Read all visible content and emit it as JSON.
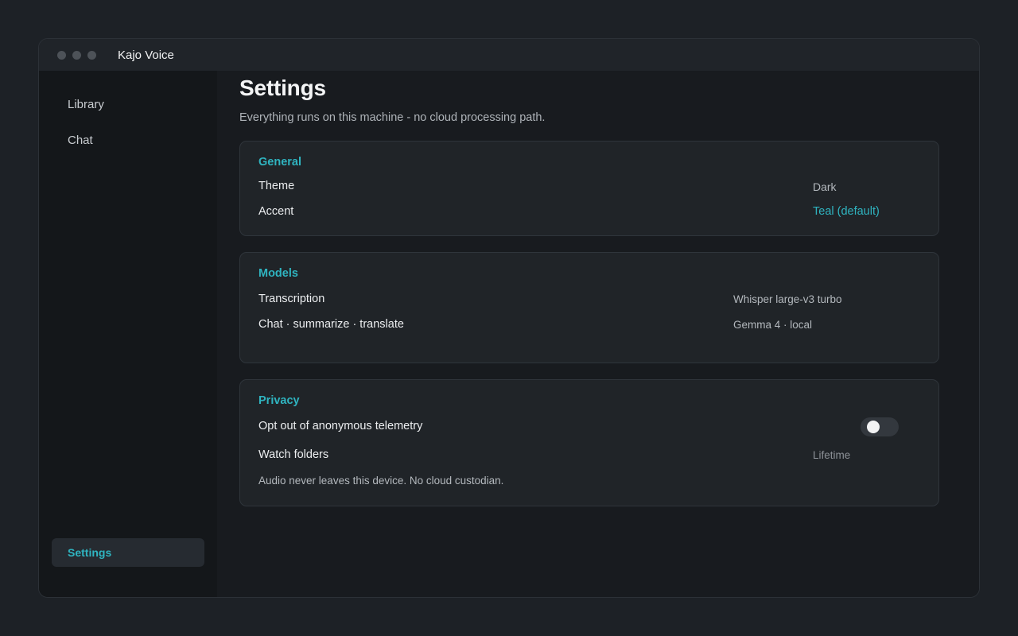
{
  "app": {
    "title": "Kajo Voice"
  },
  "sidebar": {
    "items": [
      {
        "label": "Library",
        "active": false
      },
      {
        "label": "Chat",
        "active": false
      },
      {
        "label": "Settings",
        "active": true
      }
    ]
  },
  "page": {
    "title": "Settings",
    "subtitle": "Everything runs on this machine - no cloud processing path."
  },
  "sections": {
    "general": {
      "title": "General",
      "theme_label": "Theme",
      "theme_value": "Dark",
      "accent_label": "Accent",
      "accent_value": "Teal (default)"
    },
    "models": {
      "title": "Models",
      "transcription_label": "Transcription",
      "transcription_value": "Whisper large-v3 turbo",
      "chat_label": "Chat · summarize · translate",
      "chat_value": "Gemma 4 · local"
    },
    "privacy": {
      "title": "Privacy",
      "telemetry_label": "Opt out of anonymous telemetry",
      "telemetry_enabled": false,
      "watch_label": "Watch folders",
      "watch_value": "Lifetime",
      "note": "Audio never leaves this device. No cloud custodian."
    }
  },
  "colors": {
    "accent": "#2fb4c0",
    "background": "#1d2126",
    "window": "#181b1f",
    "sidebar": "#14171a",
    "card": "#202428"
  },
  "icons": {
    "window_controls": [
      "close-dot",
      "minimize-dot",
      "zoom-dot"
    ]
  }
}
